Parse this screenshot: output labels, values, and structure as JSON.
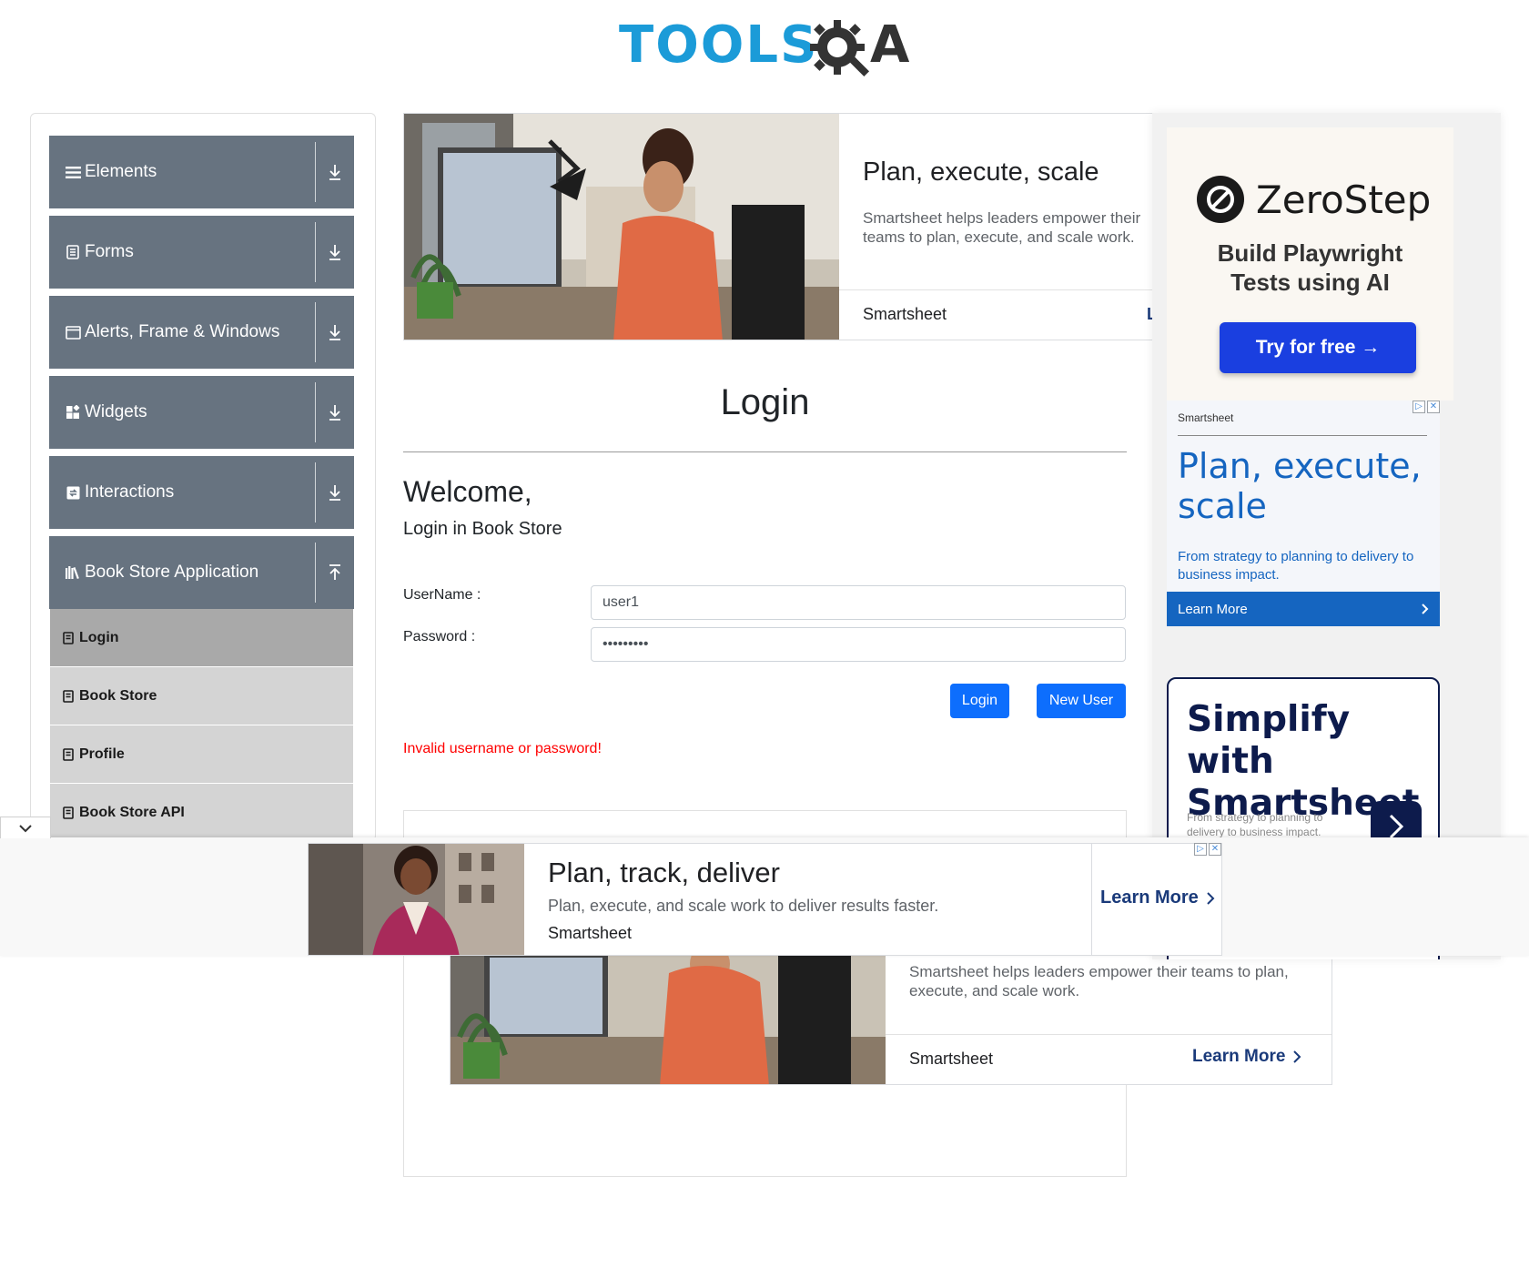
{
  "header": {
    "logo_left": "TOOLS",
    "logo_right": "A"
  },
  "sidebar": {
    "groups": [
      {
        "label": "Elements",
        "icon": "hamburger-icon"
      },
      {
        "label": "Forms",
        "icon": "form-icon"
      },
      {
        "label": "Alerts, Frame & Windows",
        "icon": "window-icon"
      },
      {
        "label": "Widgets",
        "icon": "widgets-icon"
      },
      {
        "label": "Interactions",
        "icon": "interactions-icon"
      },
      {
        "label": "Book Store Application",
        "icon": "books-icon",
        "expanded": true
      }
    ],
    "subitems": [
      {
        "label": "Login",
        "active": true
      },
      {
        "label": "Book Store"
      },
      {
        "label": "Profile"
      },
      {
        "label": "Book Store API"
      }
    ]
  },
  "top_ad": {
    "title": "Plan, execute, scale",
    "description": "Smartsheet helps leaders empower their teams to plan, execute, and scale work.",
    "brand": "Smartsheet",
    "cta_partial": "L"
  },
  "login": {
    "title": "Login",
    "welcome": "Welcome,",
    "subtitle": "Login in Book Store",
    "username_label": "UserName :",
    "username_value": "user1",
    "password_label": "Password :",
    "password_value": "•••••••••",
    "login_button": "Login",
    "new_user_button": "New User",
    "error": "Invalid username or password!"
  },
  "lower_ad": {
    "description": "Smartsheet helps leaders empower their teams to plan, execute, and scale work.",
    "brand": "Smartsheet",
    "cta": "Learn More"
  },
  "right_ads": {
    "zerostep": {
      "name": "ZeroStep",
      "tagline_1": "Build Playwright",
      "tagline_2": "Tests using AI",
      "cta": "Try for free →"
    },
    "smartsheet": {
      "brand": "Smartsheet",
      "title": "Plan, execute, scale",
      "description": "From strategy to planning to delivery to business impact.",
      "cta": "Learn More"
    },
    "simplify": {
      "title_1": "Simplify with",
      "title_2": "Smartsheet",
      "description": "From strategy to planning to delivery to business impact."
    }
  },
  "bottom_ad": {
    "title": "Plan, track, deliver",
    "description": "Plan, execute, and scale work to deliver results faster.",
    "brand": "Smartsheet",
    "cta": "Learn More"
  },
  "colors": {
    "sidebar_group": "#677380",
    "sidebar_sub": "#d4d4d4",
    "sidebar_sub_active": "#a9a9a9",
    "primary_button": "#0d6efd",
    "error": "#ff0000",
    "logo_blue": "#1b9bd8",
    "ad_blue": "#1565c0",
    "zerostep_button": "#1a3fe0"
  }
}
